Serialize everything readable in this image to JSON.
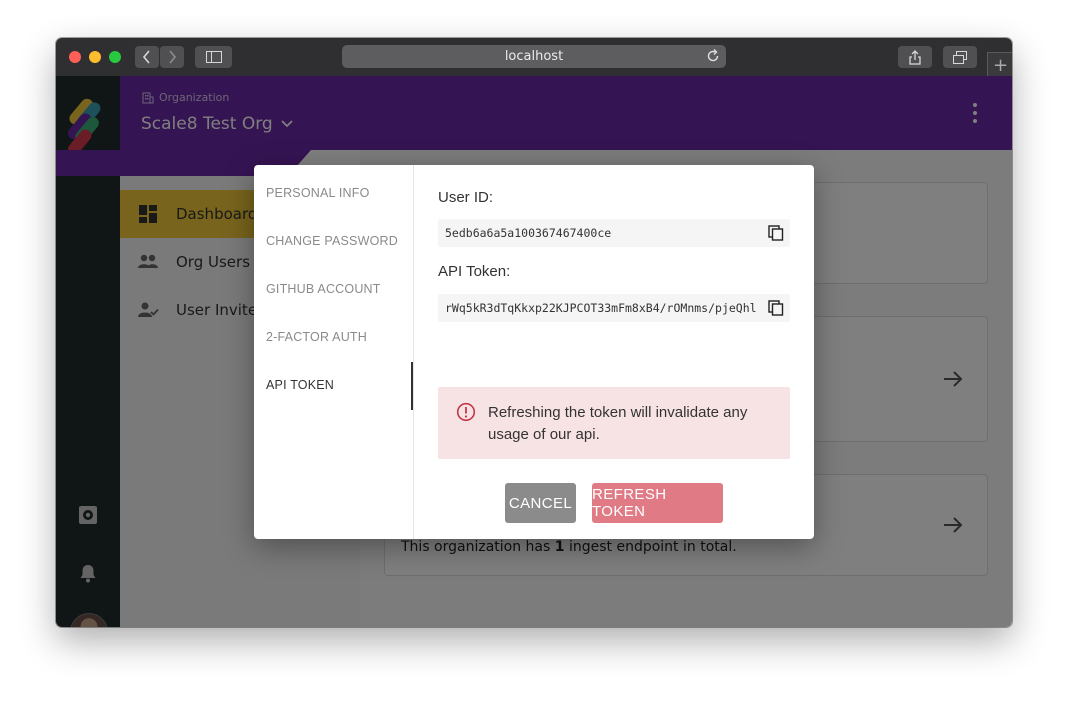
{
  "browser": {
    "url": "localhost"
  },
  "header": {
    "org_label": "Organization",
    "org_name": "Scale8 Test Org"
  },
  "sidebar": {
    "items": [
      {
        "label": "Dashboard",
        "icon": "dashboard-icon",
        "active": true
      },
      {
        "label": "Org Users",
        "icon": "people-icon"
      },
      {
        "label": "User Invites",
        "icon": "user-check-icon"
      }
    ]
  },
  "main": {
    "card3_text_prefix": "This organization has ",
    "card3_count": "1",
    "card3_text_suffix": " ingest endpoint in total."
  },
  "modal": {
    "tabs": [
      {
        "label": "PERSONAL INFO"
      },
      {
        "label": "CHANGE PASSWORD"
      },
      {
        "label": "GITHUB ACCOUNT"
      },
      {
        "label": "2-FACTOR AUTH"
      },
      {
        "label": "API TOKEN",
        "active": true
      }
    ],
    "user_id_label": "User ID:",
    "user_id_value": "5edb6a6a5a100367467400ce",
    "api_token_label": "API Token:",
    "api_token_value": "rWq5kR3dTqKkxp22KJPCOT33mFm8xB4/rOMnms/pjeQhl",
    "alert_text": "Refreshing the token will invalidate any usage of our api.",
    "cancel_label": "CANCEL",
    "refresh_label": "REFRESH TOKEN"
  },
  "colors": {
    "brand_purple": "#6b28a7",
    "active_nav": "#f0c93a",
    "alert_bg": "#f8e3e4",
    "refresh_button": "#e07b86",
    "cancel_button": "#8b8b8b"
  }
}
